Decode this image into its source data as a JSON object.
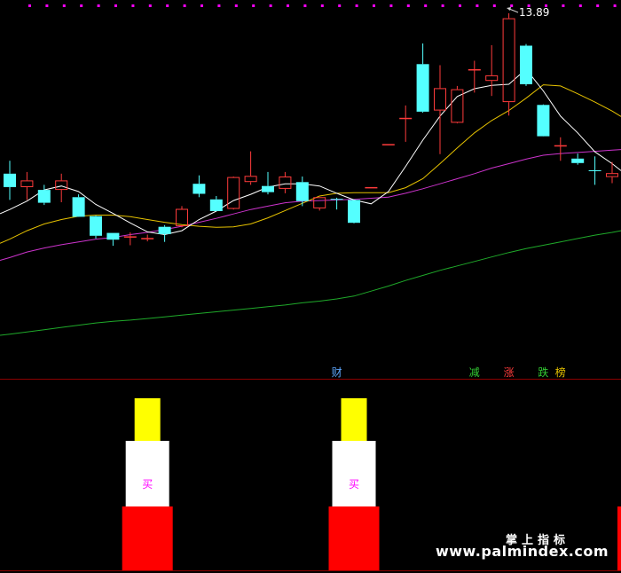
{
  "colors": {
    "background": "#000000",
    "up_candle": "#ff3b3b",
    "down_candle": "#54ffff",
    "ma5": "#ffffff",
    "ma10": "#e6c200",
    "ma20": "#cc33cc",
    "ma60": "#1faa2a",
    "divider": "#8b0000",
    "top_dots": "#ff00ff",
    "bar_red": "#ff0000",
    "bar_white": "#ffffff",
    "bar_yellow": "#ffff00",
    "buy_text": "#ff00ff"
  },
  "annotations": {
    "high_label": "13.89"
  },
  "tags": [
    {
      "text": "财",
      "color": "#5fa8ff",
      "index": 19
    },
    {
      "text": "减",
      "color": "#33cc33",
      "index": 27
    },
    {
      "text": "涨",
      "color": "#ff3b3b",
      "index": 29
    },
    {
      "text": "跌",
      "color": "#33cc33",
      "index": 31
    },
    {
      "text": "榜",
      "color": "#e6c200",
      "index": 32
    }
  ],
  "signals": [
    {
      "index": 8,
      "label": "买"
    },
    {
      "index": 20,
      "label": "买"
    }
  ],
  "watermark": {
    "line1": "掌上指标",
    "line2": "www.palmindex.com"
  },
  "chart_data": {
    "type": "candlestick",
    "ylim": [
      8.05,
      14.0
    ],
    "candles": [
      {
        "open": 11.02,
        "high": 11.25,
        "low": 10.55,
        "close": 10.78
      },
      {
        "open": 10.78,
        "high": 11.05,
        "low": 10.55,
        "close": 10.9
      },
      {
        "open": 10.73,
        "high": 10.82,
        "low": 10.46,
        "close": 10.5
      },
      {
        "open": 10.73,
        "high": 11.02,
        "low": 10.51,
        "close": 10.9
      },
      {
        "open": 10.6,
        "high": 10.65,
        "low": 10.26,
        "close": 10.25
      },
      {
        "open": 10.26,
        "high": 10.27,
        "low": 9.86,
        "close": 9.91
      },
      {
        "open": 9.96,
        "high": 9.96,
        "low": 9.73,
        "close": 9.84
      },
      {
        "open": 9.9,
        "high": 9.97,
        "low": 9.74,
        "close": 9.9
      },
      {
        "open": 9.87,
        "high": 9.93,
        "low": 9.81,
        "close": 9.87
      },
      {
        "open": 10.07,
        "high": 10.1,
        "low": 9.8,
        "close": 9.94
      },
      {
        "open": 10.08,
        "high": 10.44,
        "low": 10.06,
        "close": 10.39
      },
      {
        "open": 10.84,
        "high": 10.99,
        "low": 10.6,
        "close": 10.66
      },
      {
        "open": 10.56,
        "high": 10.62,
        "low": 10.36,
        "close": 10.35
      },
      {
        "open": 10.39,
        "high": 10.97,
        "low": 10.38,
        "close": 10.96
      },
      {
        "open": 10.87,
        "high": 11.42,
        "low": 10.82,
        "close": 10.98
      },
      {
        "open": 10.8,
        "high": 11.05,
        "low": 10.65,
        "close": 10.69
      },
      {
        "open": 10.75,
        "high": 11.05,
        "low": 10.67,
        "close": 10.97
      },
      {
        "open": 10.87,
        "high": 10.97,
        "low": 10.44,
        "close": 10.53
      },
      {
        "open": 10.4,
        "high": 10.6,
        "low": 10.36,
        "close": 10.6
      },
      {
        "open": 10.57,
        "high": 10.59,
        "low": 10.38,
        "close": 10.56
      },
      {
        "open": 10.55,
        "high": 10.55,
        "low": 10.13,
        "close": 10.14
      },
      {
        "open": 10.78,
        "high": 10.78,
        "low": 10.78,
        "close": 10.78
      },
      {
        "open": 11.55,
        "high": 11.55,
        "low": 11.55,
        "close": 11.55
      },
      {
        "open": 12.0,
        "high": 12.24,
        "low": 11.59,
        "close": 12.02
      },
      {
        "open": 12.98,
        "high": 13.35,
        "low": 12.11,
        "close": 12.13
      },
      {
        "open": 12.15,
        "high": 12.96,
        "low": 11.37,
        "close": 12.55
      },
      {
        "open": 11.93,
        "high": 12.59,
        "low": 11.92,
        "close": 12.53
      },
      {
        "open": 12.88,
        "high": 13.04,
        "low": 12.47,
        "close": 12.89
      },
      {
        "open": 12.68,
        "high": 13.32,
        "low": 12.41,
        "close": 12.78
      },
      {
        "open": 12.3,
        "high": 13.89,
        "low": 12.06,
        "close": 13.8
      },
      {
        "open": 13.31,
        "high": 13.34,
        "low": 12.59,
        "close": 12.62
      },
      {
        "open": 12.25,
        "high": 12.26,
        "low": 11.7,
        "close": 11.69
      },
      {
        "open": 11.52,
        "high": 11.67,
        "low": 11.25,
        "close": 11.53
      },
      {
        "open": 11.29,
        "high": 11.38,
        "low": 11.18,
        "close": 11.21
      },
      {
        "open": 11.08,
        "high": 11.33,
        "low": 10.82,
        "close": 11.07
      },
      {
        "open": 10.96,
        "high": 11.23,
        "low": 10.85,
        "close": 11.03
      }
    ],
    "series": [
      {
        "key": "ma5",
        "color": "#ffffff",
        "values": [
          10.38,
          10.53,
          10.73,
          10.8,
          10.7,
          10.47,
          10.31,
          10.14,
          9.98,
          9.93,
          10.0,
          10.2,
          10.35,
          10.54,
          10.65,
          10.78,
          10.84,
          10.84,
          10.8,
          10.67,
          10.55,
          10.48,
          10.7,
          11.15,
          11.62,
          12.05,
          12.4,
          12.54,
          12.6,
          12.62,
          12.89,
          12.5,
          12.05,
          11.75,
          11.41,
          11.2
        ]
      },
      {
        "key": "ma10",
        "color": "#e6c200",
        "values": [
          9.85,
          10.0,
          10.12,
          10.2,
          10.26,
          10.28,
          10.28,
          10.25,
          10.2,
          10.15,
          10.11,
          10.08,
          10.06,
          10.07,
          10.12,
          10.23,
          10.36,
          10.49,
          10.62,
          10.67,
          10.68,
          10.68,
          10.68,
          10.77,
          10.93,
          11.2,
          11.48,
          11.75,
          11.97,
          12.15,
          12.37,
          12.61,
          12.59,
          12.45,
          12.3,
          12.14
        ]
      },
      {
        "key": "ma20",
        "color": "#cc33cc",
        "values": [
          9.52,
          9.62,
          9.69,
          9.75,
          9.8,
          9.85,
          9.88,
          9.93,
          9.97,
          10.02,
          10.08,
          10.15,
          10.22,
          10.3,
          10.38,
          10.44,
          10.5,
          10.53,
          10.54,
          10.55,
          10.56,
          10.58,
          10.6,
          10.67,
          10.75,
          10.84,
          10.93,
          11.02,
          11.12,
          11.2,
          11.28,
          11.35,
          11.38,
          11.4,
          11.42,
          11.44
        ]
      },
      {
        "key": "ma60",
        "color": "#1faa2a",
        "values": [
          8.15,
          8.19,
          8.23,
          8.27,
          8.31,
          8.35,
          8.38,
          8.4,
          8.43,
          8.46,
          8.49,
          8.52,
          8.55,
          8.58,
          8.61,
          8.64,
          8.67,
          8.71,
          8.74,
          8.78,
          8.83,
          8.92,
          9.01,
          9.11,
          9.2,
          9.29,
          9.37,
          9.45,
          9.53,
          9.61,
          9.68,
          9.74,
          9.8,
          9.86,
          9.92,
          9.97
        ]
      }
    ]
  }
}
